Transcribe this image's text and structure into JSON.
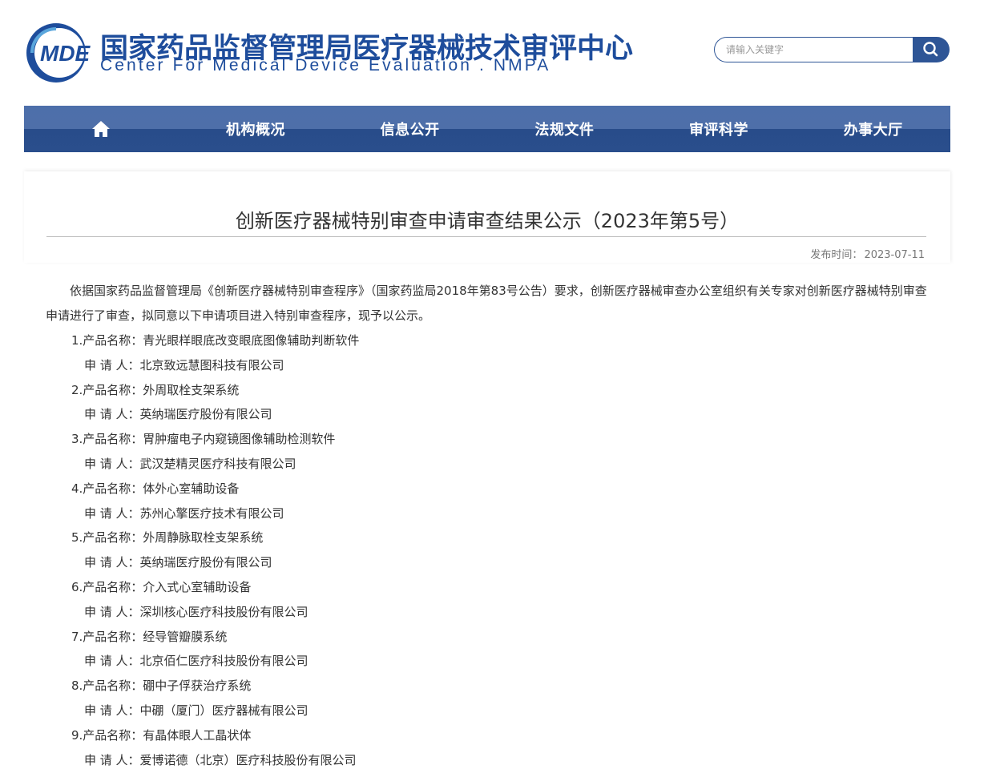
{
  "header": {
    "logo_text": "MDE",
    "cn_title": "国家药品监督管理局医疗器械技术审评中心",
    "en_title": "Center For Medical Device Evaluation . NMPA"
  },
  "search": {
    "placeholder": "请输入关键字",
    "icon": "search-icon"
  },
  "nav": {
    "home_icon": "home-icon",
    "items": [
      "机构概况",
      "信息公开",
      "法规文件",
      "审评科学",
      "办事大厅"
    ]
  },
  "article": {
    "title": "创新医疗器械特别审查申请审查结果公示（2023年第5号）",
    "date_label": "发布时间：",
    "date": "2023-07-11",
    "intro": "依据国家药品监督管理局《创新医疗器械特别审查程序》（国家药监局2018年第83号公告）要求，创新医疗器械审查办公室组织有关专家对创新医疗器械特别审查申请进行了审查，拟同意以下申请项目进入特别审查程序，现予以公示。",
    "entries": [
      {
        "product": "1.产品名称：青光眼样眼底改变眼底图像辅助判断软件",
        "applicant": "申 请 人：北京致远慧图科技有限公司"
      },
      {
        "product": "2.产品名称：外周取栓支架系统",
        "applicant": "申 请 人：英纳瑞医疗股份有限公司"
      },
      {
        "product": "3.产品名称：胃肿瘤电子内窥镜图像辅助检测软件",
        "applicant": "申 请 人：武汉楚精灵医疗科技有限公司"
      },
      {
        "product": "4.产品名称：体外心室辅助设备",
        "applicant": "申 请 人：苏州心擎医疗技术有限公司"
      },
      {
        "product": "5.产品名称：外周静脉取栓支架系统",
        "applicant": "申 请 人：英纳瑞医疗股份有限公司"
      },
      {
        "product": "6.产品名称：介入式心室辅助设备",
        "applicant": "申 请 人：深圳核心医疗科技股份有限公司"
      },
      {
        "product": "7.产品名称：经导管瓣膜系统",
        "applicant": "申 请 人：北京佰仁医疗科技股份有限公司"
      },
      {
        "product": "8.产品名称：硼中子俘获治疗系统",
        "applicant": "申 请 人：中硼（厦门）医疗器械有限公司"
      },
      {
        "product": "9.产品名称：有晶体眼人工晶状体",
        "applicant": "申 请 人：爱博诺德（北京）医疗科技股份有限公司"
      }
    ]
  },
  "colors": {
    "brand_blue": "#1e4d9c",
    "nav_top": "#4d6faa",
    "nav_bottom": "#284c8a"
  }
}
